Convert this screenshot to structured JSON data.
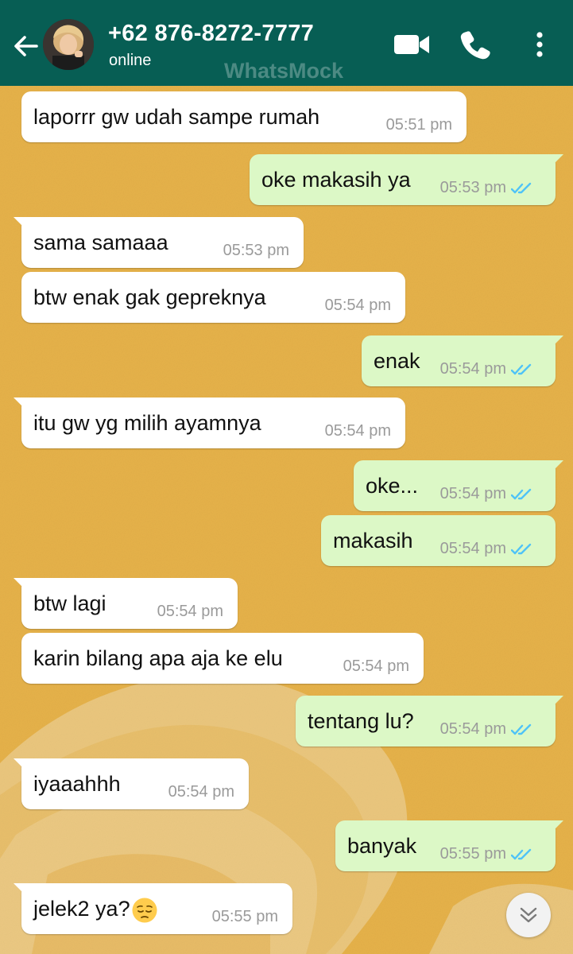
{
  "header": {
    "contact_name": "+62 876-8272-7777",
    "status": "online",
    "watermark": "WhatsMock",
    "back_icon": "arrow-left-icon",
    "video_icon": "video-camera-icon",
    "call_icon": "phone-icon",
    "menu_icon": "more-vertical-icon",
    "color": "#075e54"
  },
  "colors": {
    "incoming_bubble": "#ffffff",
    "outgoing_bubble": "#dcf8c6",
    "tick_read": "#4fc3f7",
    "wallpaper": "#e6b24a"
  },
  "messages": [
    {
      "direction": "in",
      "text": "laporrr gw udah sampe rumah",
      "time": "05:51 pm"
    },
    {
      "direction": "out",
      "text": "oke makasih ya",
      "time": "05:53 pm",
      "status": "read"
    },
    {
      "direction": "in",
      "text": "sama samaaa",
      "time": "05:53 pm"
    },
    {
      "direction": "in",
      "text": "btw enak gak gepreknya",
      "time": "05:54 pm"
    },
    {
      "direction": "out",
      "text": "enak",
      "time": "05:54 pm",
      "status": "read"
    },
    {
      "direction": "in",
      "text": "itu gw yg milih ayamnya",
      "time": "05:54 pm"
    },
    {
      "direction": "out",
      "text": "oke...",
      "time": "05:54 pm",
      "status": "read"
    },
    {
      "direction": "out",
      "text": "makasih",
      "time": "05:54 pm",
      "status": "read"
    },
    {
      "direction": "in",
      "text": "btw lagi",
      "time": "05:54 pm"
    },
    {
      "direction": "in",
      "text": "karin bilang apa aja ke elu",
      "time": "05:54 pm"
    },
    {
      "direction": "out",
      "text": "tentang lu?",
      "time": "05:54 pm",
      "status": "read"
    },
    {
      "direction": "in",
      "text": "iyaaahhh",
      "time": "05:54 pm"
    },
    {
      "direction": "out",
      "text": "banyak",
      "time": "05:55 pm",
      "status": "read"
    },
    {
      "direction": "in",
      "text": "jelek2 ya?",
      "time": "05:55 pm",
      "emoji": "pensive-face"
    }
  ],
  "scroll_button_icon": "chevron-double-down-icon"
}
